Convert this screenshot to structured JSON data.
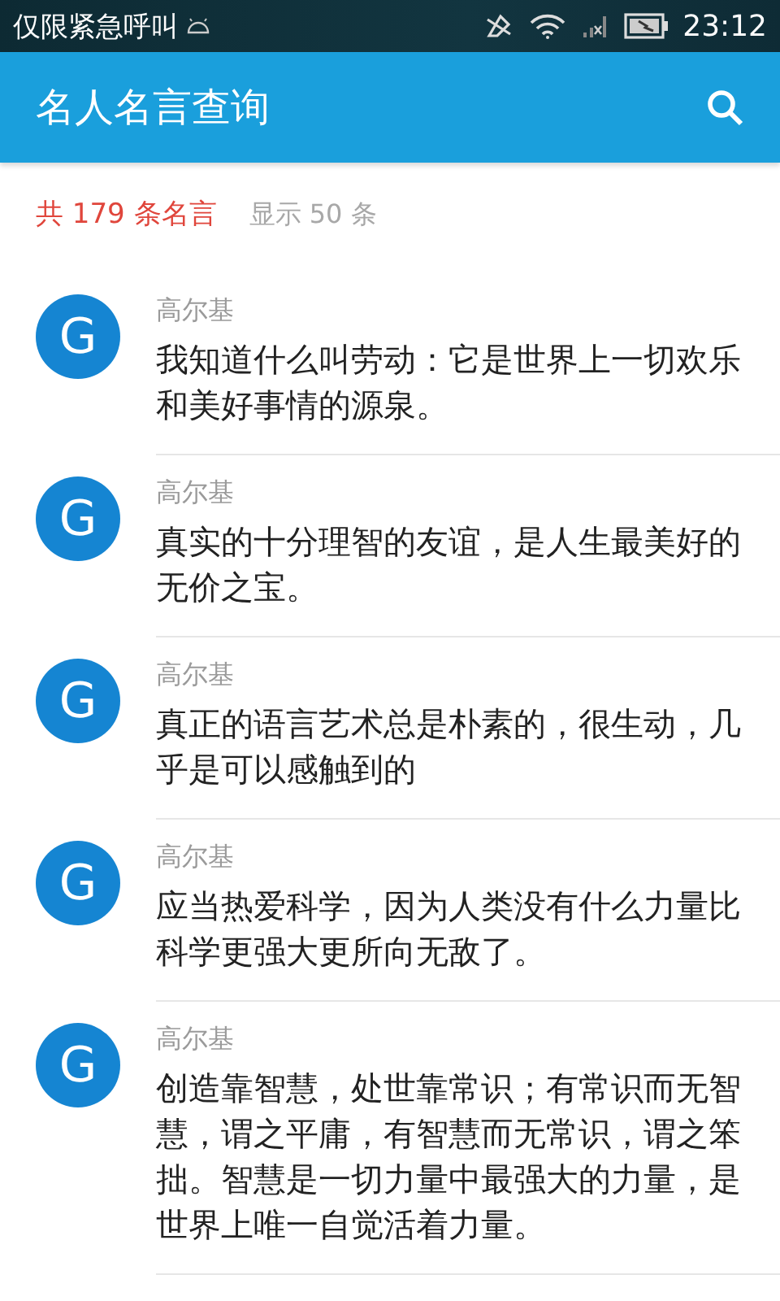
{
  "status_bar": {
    "carrier": "仅限紧急呼叫",
    "time": "23:12"
  },
  "app_bar": {
    "title": "名人名言查询"
  },
  "summary": {
    "total": "共 179 条名言",
    "shown": "显示 50 条"
  },
  "quotes": [
    {
      "avatar": "G",
      "author": "高尔基",
      "text": "我知道什么叫劳动：它是世界上一切欢乐和美好事情的源泉。"
    },
    {
      "avatar": "G",
      "author": "高尔基",
      "text": "真实的十分理智的友谊，是人生最美好的无价之宝。"
    },
    {
      "avatar": "G",
      "author": "高尔基",
      "text": "真正的语言艺术总是朴素的，很生动，几乎是可以感触到的"
    },
    {
      "avatar": "G",
      "author": "高尔基",
      "text": "应当热爱科学，因为人类没有什么力量比科学更强大更所向无敌了。"
    },
    {
      "avatar": "G",
      "author": "高尔基",
      "text": "创造靠智慧，处世靠常识；有常识而无智慧，谓之平庸，有智慧而无常识，谓之笨拙。智慧是一切力量中最强大的力量，是世界上唯一自觉活着力量。"
    }
  ]
}
